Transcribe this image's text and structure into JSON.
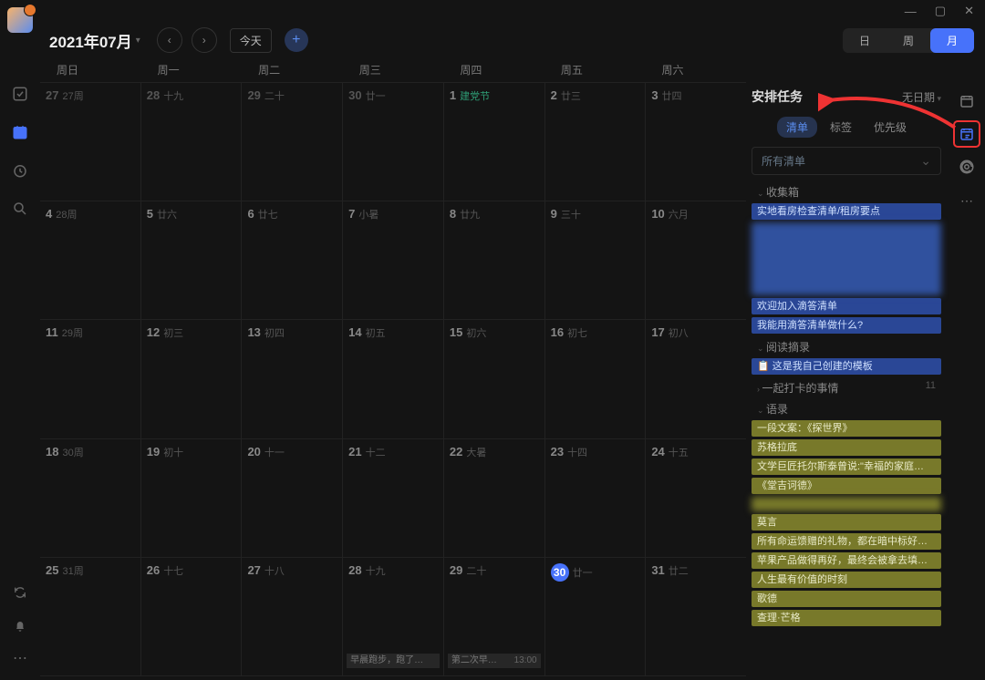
{
  "window": {
    "min": "—",
    "max": "▢",
    "close": "✕"
  },
  "header": {
    "title": "2021年07月",
    "today": "今天",
    "views": {
      "day": "日",
      "week": "周",
      "month": "月"
    }
  },
  "dow": [
    "周日",
    "周一",
    "周二",
    "周三",
    "周四",
    "周五",
    "周六"
  ],
  "weeks": [
    [
      {
        "n": "27",
        "l": "27周",
        "dim": true
      },
      {
        "n": "28",
        "l": "十九",
        "dim": true
      },
      {
        "n": "29",
        "l": "二十",
        "dim": true
      },
      {
        "n": "30",
        "l": "廿一",
        "dim": true
      },
      {
        "n": "1",
        "hol": "建党节"
      },
      {
        "n": "2",
        "l": "廿三"
      },
      {
        "n": "3",
        "l": "廿四"
      }
    ],
    [
      {
        "n": "4",
        "l": "28周"
      },
      {
        "n": "5",
        "l": "廿六"
      },
      {
        "n": "6",
        "l": "廿七"
      },
      {
        "n": "7",
        "l": "小暑"
      },
      {
        "n": "8",
        "l": "廿九"
      },
      {
        "n": "9",
        "l": "三十"
      },
      {
        "n": "10",
        "l": "六月"
      }
    ],
    [
      {
        "n": "11",
        "l": "29周"
      },
      {
        "n": "12",
        "l": "初三"
      },
      {
        "n": "13",
        "l": "初四"
      },
      {
        "n": "14",
        "l": "初五"
      },
      {
        "n": "15",
        "l": "初六"
      },
      {
        "n": "16",
        "l": "初七"
      },
      {
        "n": "17",
        "l": "初八"
      }
    ],
    [
      {
        "n": "18",
        "l": "30周"
      },
      {
        "n": "19",
        "l": "初十"
      },
      {
        "n": "20",
        "l": "十一"
      },
      {
        "n": "21",
        "l": "十二"
      },
      {
        "n": "22",
        "l": "大暑"
      },
      {
        "n": "23",
        "l": "十四"
      },
      {
        "n": "24",
        "l": "十五"
      }
    ],
    [
      {
        "n": "25",
        "l": "31周"
      },
      {
        "n": "26",
        "l": "十七"
      },
      {
        "n": "27",
        "l": "十八"
      },
      {
        "n": "28",
        "l": "十九",
        "ev": {
          "t": "早晨跑步，跑了…"
        }
      },
      {
        "n": "29",
        "l": "二十",
        "ev": {
          "t": "第二次早…",
          "time": "13:00"
        }
      },
      {
        "n": "30",
        "l": "廿一",
        "today": true
      },
      {
        "n": "31",
        "l": "廿二"
      }
    ]
  ],
  "panel": {
    "title": "安排任务",
    "no_date": "无日期",
    "tabs": {
      "list": "清单",
      "tag": "标签",
      "priority": "优先级"
    },
    "select": "所有清单",
    "sections": [
      {
        "name": "收集箱",
        "tasks": [
          {
            "t": "实地看房检查清单/租房要点",
            "c": "blue"
          },
          {
            "t": "",
            "c": "blue",
            "blur": true
          },
          {
            "t": "欢迎加入滴答清单",
            "c": "blue"
          },
          {
            "t": "我能用滴答清单做什么?",
            "c": "blue"
          }
        ]
      },
      {
        "name": "阅读摘录",
        "tasks": [
          {
            "t": "这是我自己创建的模板",
            "c": "blue",
            "icon": "📋"
          }
        ]
      },
      {
        "name": "一起打卡的事情",
        "closed": true,
        "count": "11"
      },
      {
        "name": "语录",
        "tasks": [
          {
            "t": "一段文案：《探世界》",
            "c": "olive"
          },
          {
            "t": "苏格拉底",
            "c": "olive"
          },
          {
            "t": "文学巨匠托尔斯泰曾说:\"幸福的家庭…",
            "c": "olive"
          },
          {
            "t": "《堂吉诃德》",
            "c": "olive"
          },
          {
            "t": "",
            "c": "olive",
            "blur": true
          },
          {
            "t": "莫言",
            "c": "olive"
          },
          {
            "t": "所有命运馈赠的礼物，都在暗中标好…",
            "c": "olive"
          },
          {
            "t": "苹果产品做得再好，最终会被拿去填…",
            "c": "olive"
          },
          {
            "t": "人生最有价值的时刻",
            "c": "olive"
          },
          {
            "t": "歌德",
            "c": "olive"
          },
          {
            "t": "查理·芒格",
            "c": "olive"
          }
        ]
      }
    ]
  }
}
